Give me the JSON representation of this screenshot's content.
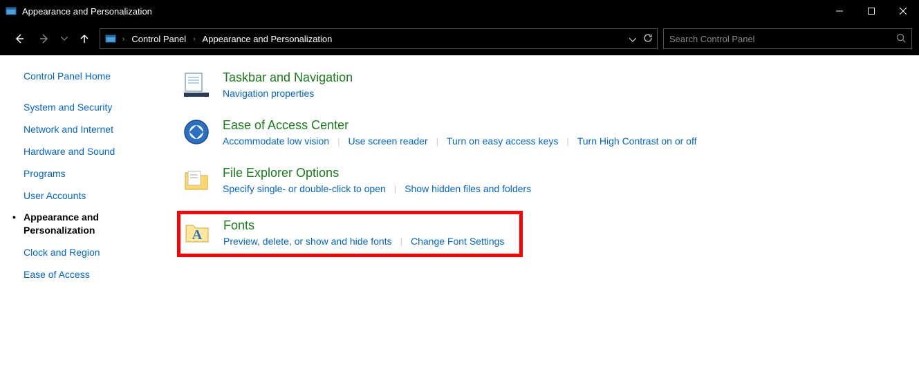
{
  "window": {
    "title": "Appearance and Personalization"
  },
  "address": {
    "root": "Control Panel",
    "current": "Appearance and Personalization"
  },
  "search": {
    "placeholder": "Search Control Panel"
  },
  "sidebar": {
    "home": "Control Panel Home",
    "items": [
      {
        "label": "System and Security"
      },
      {
        "label": "Network and Internet"
      },
      {
        "label": "Hardware and Sound"
      },
      {
        "label": "Programs"
      },
      {
        "label": "User Accounts"
      },
      {
        "label": "Appearance and Personalization",
        "current": true
      },
      {
        "label": "Clock and Region"
      },
      {
        "label": "Ease of Access"
      }
    ]
  },
  "categories": [
    {
      "title": "Taskbar and Navigation",
      "links": [
        "Navigation properties"
      ]
    },
    {
      "title": "Ease of Access Center",
      "links": [
        "Accommodate low vision",
        "Use screen reader",
        "Turn on easy access keys",
        "Turn High Contrast on or off"
      ]
    },
    {
      "title": "File Explorer Options",
      "links": [
        "Specify single- or double-click to open",
        "Show hidden files and folders"
      ]
    },
    {
      "title": "Fonts",
      "links": [
        "Preview, delete, or show and hide fonts",
        "Change Font Settings"
      ],
      "highlighted": true
    }
  ]
}
